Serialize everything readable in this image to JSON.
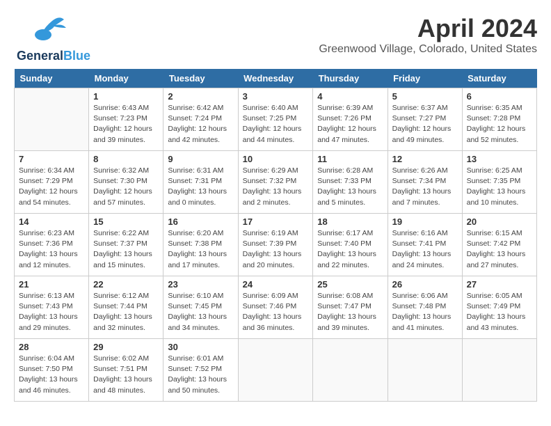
{
  "header": {
    "logo_general": "General",
    "logo_blue": "Blue",
    "title": "April 2024",
    "subtitle": "Greenwood Village, Colorado, United States"
  },
  "days_of_week": [
    "Sunday",
    "Monday",
    "Tuesday",
    "Wednesday",
    "Thursday",
    "Friday",
    "Saturday"
  ],
  "weeks": [
    [
      {
        "day": "",
        "sunrise": "",
        "sunset": "",
        "daylight": ""
      },
      {
        "day": "1",
        "sunrise": "6:43 AM",
        "sunset": "7:23 PM",
        "daylight": "12 hours and 39 minutes."
      },
      {
        "day": "2",
        "sunrise": "6:42 AM",
        "sunset": "7:24 PM",
        "daylight": "12 hours and 42 minutes."
      },
      {
        "day": "3",
        "sunrise": "6:40 AM",
        "sunset": "7:25 PM",
        "daylight": "12 hours and 44 minutes."
      },
      {
        "day": "4",
        "sunrise": "6:39 AM",
        "sunset": "7:26 PM",
        "daylight": "12 hours and 47 minutes."
      },
      {
        "day": "5",
        "sunrise": "6:37 AM",
        "sunset": "7:27 PM",
        "daylight": "12 hours and 49 minutes."
      },
      {
        "day": "6",
        "sunrise": "6:35 AM",
        "sunset": "7:28 PM",
        "daylight": "12 hours and 52 minutes."
      }
    ],
    [
      {
        "day": "7",
        "sunrise": "6:34 AM",
        "sunset": "7:29 PM",
        "daylight": "12 hours and 54 minutes."
      },
      {
        "day": "8",
        "sunrise": "6:32 AM",
        "sunset": "7:30 PM",
        "daylight": "12 hours and 57 minutes."
      },
      {
        "day": "9",
        "sunrise": "6:31 AM",
        "sunset": "7:31 PM",
        "daylight": "13 hours and 0 minutes."
      },
      {
        "day": "10",
        "sunrise": "6:29 AM",
        "sunset": "7:32 PM",
        "daylight": "13 hours and 2 minutes."
      },
      {
        "day": "11",
        "sunrise": "6:28 AM",
        "sunset": "7:33 PM",
        "daylight": "13 hours and 5 minutes."
      },
      {
        "day": "12",
        "sunrise": "6:26 AM",
        "sunset": "7:34 PM",
        "daylight": "13 hours and 7 minutes."
      },
      {
        "day": "13",
        "sunrise": "6:25 AM",
        "sunset": "7:35 PM",
        "daylight": "13 hours and 10 minutes."
      }
    ],
    [
      {
        "day": "14",
        "sunrise": "6:23 AM",
        "sunset": "7:36 PM",
        "daylight": "13 hours and 12 minutes."
      },
      {
        "day": "15",
        "sunrise": "6:22 AM",
        "sunset": "7:37 PM",
        "daylight": "13 hours and 15 minutes."
      },
      {
        "day": "16",
        "sunrise": "6:20 AM",
        "sunset": "7:38 PM",
        "daylight": "13 hours and 17 minutes."
      },
      {
        "day": "17",
        "sunrise": "6:19 AM",
        "sunset": "7:39 PM",
        "daylight": "13 hours and 20 minutes."
      },
      {
        "day": "18",
        "sunrise": "6:17 AM",
        "sunset": "7:40 PM",
        "daylight": "13 hours and 22 minutes."
      },
      {
        "day": "19",
        "sunrise": "6:16 AM",
        "sunset": "7:41 PM",
        "daylight": "13 hours and 24 minutes."
      },
      {
        "day": "20",
        "sunrise": "6:15 AM",
        "sunset": "7:42 PM",
        "daylight": "13 hours and 27 minutes."
      }
    ],
    [
      {
        "day": "21",
        "sunrise": "6:13 AM",
        "sunset": "7:43 PM",
        "daylight": "13 hours and 29 minutes."
      },
      {
        "day": "22",
        "sunrise": "6:12 AM",
        "sunset": "7:44 PM",
        "daylight": "13 hours and 32 minutes."
      },
      {
        "day": "23",
        "sunrise": "6:10 AM",
        "sunset": "7:45 PM",
        "daylight": "13 hours and 34 minutes."
      },
      {
        "day": "24",
        "sunrise": "6:09 AM",
        "sunset": "7:46 PM",
        "daylight": "13 hours and 36 minutes."
      },
      {
        "day": "25",
        "sunrise": "6:08 AM",
        "sunset": "7:47 PM",
        "daylight": "13 hours and 39 minutes."
      },
      {
        "day": "26",
        "sunrise": "6:06 AM",
        "sunset": "7:48 PM",
        "daylight": "13 hours and 41 minutes."
      },
      {
        "day": "27",
        "sunrise": "6:05 AM",
        "sunset": "7:49 PM",
        "daylight": "13 hours and 43 minutes."
      }
    ],
    [
      {
        "day": "28",
        "sunrise": "6:04 AM",
        "sunset": "7:50 PM",
        "daylight": "13 hours and 46 minutes."
      },
      {
        "day": "29",
        "sunrise": "6:02 AM",
        "sunset": "7:51 PM",
        "daylight": "13 hours and 48 minutes."
      },
      {
        "day": "30",
        "sunrise": "6:01 AM",
        "sunset": "7:52 PM",
        "daylight": "13 hours and 50 minutes."
      },
      {
        "day": "",
        "sunrise": "",
        "sunset": "",
        "daylight": ""
      },
      {
        "day": "",
        "sunrise": "",
        "sunset": "",
        "daylight": ""
      },
      {
        "day": "",
        "sunrise": "",
        "sunset": "",
        "daylight": ""
      },
      {
        "day": "",
        "sunrise": "",
        "sunset": "",
        "daylight": ""
      }
    ]
  ],
  "labels": {
    "sunrise_prefix": "Sunrise: ",
    "sunset_prefix": "Sunset: ",
    "daylight_prefix": "Daylight: "
  }
}
